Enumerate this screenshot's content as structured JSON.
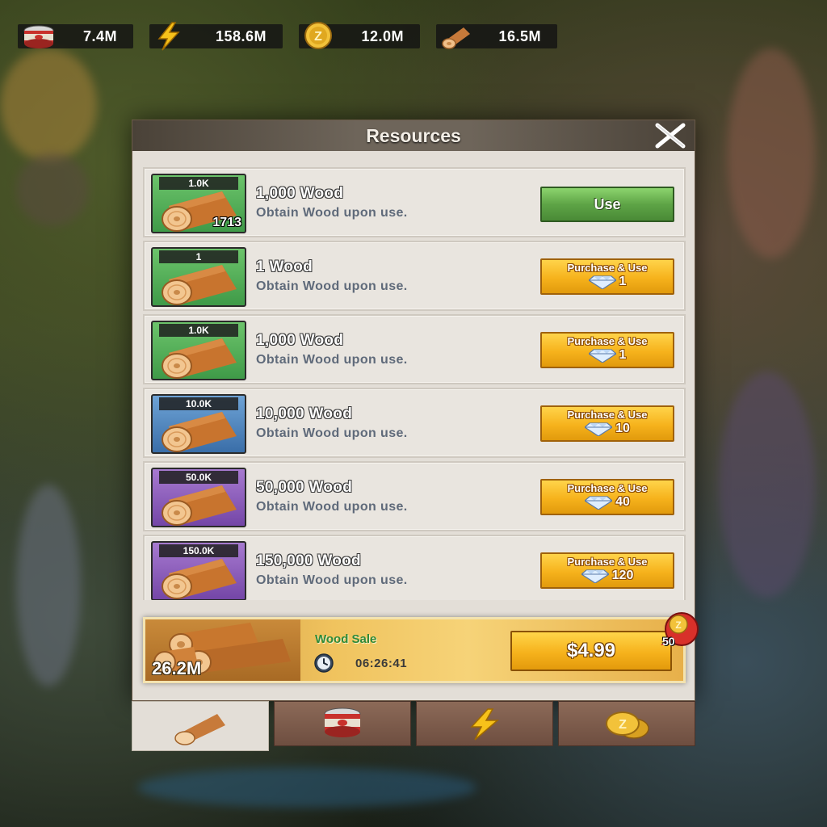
{
  "top_bar": {
    "resources": [
      {
        "name": "food",
        "icon": "food-can-icon",
        "value": "7.4M"
      },
      {
        "name": "energy",
        "icon": "lightning-icon",
        "value": "158.6M"
      },
      {
        "name": "coins",
        "icon": "coin-icon",
        "value": "12.0M"
      },
      {
        "name": "wood",
        "icon": "wood-log-icon",
        "value": "16.5M"
      }
    ]
  },
  "panel": {
    "title": "Resources",
    "close_icon": "close-icon"
  },
  "items": [
    {
      "tag": "1.0K",
      "count": "1713",
      "tier": "green",
      "title": "1,000 Wood",
      "desc": "Obtain Wood upon use.",
      "action": "use",
      "button_label": "Use",
      "price": ""
    },
    {
      "tag": "1",
      "count": "",
      "tier": "green",
      "title": "1 Wood",
      "desc": "Obtain Wood upon use.",
      "action": "purchase",
      "button_label": "Purchase & Use",
      "price": "1"
    },
    {
      "tag": "1.0K",
      "count": "",
      "tier": "green",
      "title": "1,000 Wood",
      "desc": "Obtain Wood upon use.",
      "action": "purchase",
      "button_label": "Purchase & Use",
      "price": "1"
    },
    {
      "tag": "10.0K",
      "count": "",
      "tier": "blue",
      "title": "10,000 Wood",
      "desc": "Obtain Wood upon use.",
      "action": "purchase",
      "button_label": "Purchase & Use",
      "price": "10"
    },
    {
      "tag": "50.0K",
      "count": "",
      "tier": "purple",
      "title": "50,000 Wood",
      "desc": "Obtain Wood upon use.",
      "action": "purchase",
      "button_label": "Purchase & Use",
      "price": "40"
    },
    {
      "tag": "150.0K",
      "count": "",
      "tier": "purple",
      "title": "150,000 Wood",
      "desc": "Obtain Wood upon use.",
      "action": "purchase",
      "button_label": "Purchase & Use",
      "price": "120"
    }
  ],
  "sale": {
    "amount": "26.2M",
    "title": "Wood Sale",
    "timer": "06:26:41",
    "price": "$4.99",
    "bonus": "50"
  },
  "tabs": [
    {
      "name": "wood",
      "icon": "wood-log-icon",
      "active": true
    },
    {
      "name": "food",
      "icon": "food-can-icon",
      "active": false
    },
    {
      "name": "energy",
      "icon": "lightning-icon",
      "active": false
    },
    {
      "name": "coins",
      "icon": "coin-icon",
      "active": false
    }
  ],
  "colors": {
    "use_button": "#5ea446",
    "purchase_button": "#f6b21c",
    "tier_green": "#4fa858",
    "tier_blue": "#4a80ba",
    "tier_purple": "#8a5abb"
  }
}
